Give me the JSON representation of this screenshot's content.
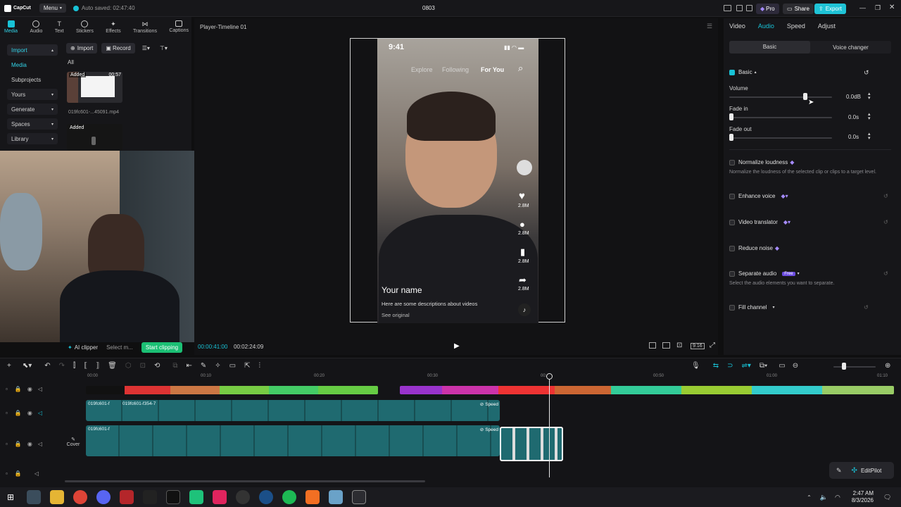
{
  "titlebar": {
    "app": "CapCut",
    "menu": "Menu",
    "autosave": "Auto saved: 02:47:40",
    "project": "0803",
    "pro": "Pro",
    "share": "Share",
    "export": "Export"
  },
  "media_tabs": [
    "Media",
    "Audio",
    "Text",
    "Stickers",
    "Effects",
    "Transitions",
    "Captions"
  ],
  "sidebar": {
    "items": [
      "Import",
      "Media",
      "Subprojects",
      "Yours",
      "Generate",
      "Spaces",
      "Library"
    ]
  },
  "media_toolbar": {
    "import": "Import",
    "record": "Record",
    "filter_all": "All"
  },
  "media_items": [
    {
      "badge": "Added",
      "duration": "00:57",
      "name": "019fc601-...45091.mp4"
    },
    {
      "badge": "Added",
      "duration": "",
      "name": ""
    }
  ],
  "player": {
    "title": "Player-Timeline 01",
    "current_time": "00:00:41:00",
    "total_time": "00:02:24:09",
    "ratio": "9:16"
  },
  "phone": {
    "time": "9:41",
    "nav": [
      "Explore",
      "Following",
      "For You"
    ],
    "likes": "2.8M",
    "comments": "2.8M",
    "saves": "2.8M",
    "shares": "2.8M",
    "name": "Your name",
    "desc": "Here are some descriptions about videos",
    "see_original": "See original"
  },
  "clipper": {
    "ai_clipper": "AI clipper",
    "select": "Select m...",
    "start": "Start clipping"
  },
  "inspector": {
    "tabs": [
      "Video",
      "Audio",
      "Speed",
      "Adjust"
    ],
    "subtabs": [
      "Basic",
      "Voice changer"
    ],
    "basic": "Basic",
    "volume_label": "Volume",
    "volume_value": "0.0dB",
    "volume_level": 0.74,
    "fade_in_label": "Fade in",
    "fade_in_value": "0.0s",
    "fade_out_label": "Fade out",
    "fade_out_value": "0.0s",
    "normalize": "Normalize loudness",
    "normalize_desc": "Normalize the loudness of the selected clip or clips to a target level.",
    "enhance": "Enhance voice",
    "translator": "Video translator",
    "reduce_noise": "Reduce noise",
    "separate": "Separate audio",
    "separate_badge": "Free",
    "separate_desc": "Select the audio elements you want to separate.",
    "fill_channel": "Fill channel"
  },
  "timeline": {
    "ruler": [
      "00:00",
      "00:10",
      "00:20",
      "00:30",
      "00:40",
      "00:50",
      "01:00",
      "01:10"
    ],
    "clip_label": "019fc601-f",
    "clip_label_long": "019fc601-f354-7",
    "speed_label": "Speed",
    "cover": "Cover"
  },
  "editpilot": "EditPilot",
  "taskbar": {
    "time": "2:47 AM",
    "date": "8/3/2026"
  },
  "colors": {
    "accent": "#18c2d6",
    "export": "#1fc3d6",
    "bg": "#0f0f10",
    "panel": "#161619"
  }
}
